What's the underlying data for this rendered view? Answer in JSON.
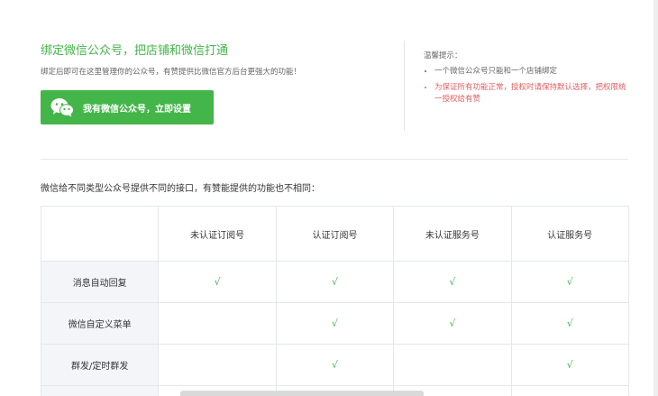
{
  "bind": {
    "title": "绑定微信公众号，把店铺和微信打通",
    "description": "绑定后即可在这里管理你的公众号，有赞提供比微信官方后台更强大的功能！",
    "setup_button_label": "我有微信公众号，立即设置"
  },
  "tips": {
    "title": "温馨提示：",
    "items": [
      "一个微信公众号只能和一个店铺绑定",
      "为保证所有功能正常，授权时请保持默认选择，把权限统一授权给有赞"
    ]
  },
  "comparison": {
    "title": "微信给不同类型公众号提供不同的接口，有赞能提供的功能也不相同：",
    "headers": [
      "",
      "未认证订阅号",
      "认证订阅号",
      "未认证服务号",
      "认证服务号"
    ],
    "rows": [
      {
        "feature": "消息自动回复",
        "cells": [
          "√",
          "√",
          "√",
          "√"
        ]
      },
      {
        "feature": "微信自定义菜单",
        "cells": [
          "",
          "√",
          "√",
          "√"
        ]
      },
      {
        "feature": "群发/定时群发",
        "cells": [
          "",
          "√",
          "",
          "√"
        ]
      },
      {
        "feature": "",
        "cells": [
          "",
          "",
          "",
          ""
        ]
      }
    ]
  },
  "colors": {
    "accent": "#44b549",
    "warning": "#e15f63"
  },
  "icons": {
    "setup_button": "wechat-icon"
  }
}
